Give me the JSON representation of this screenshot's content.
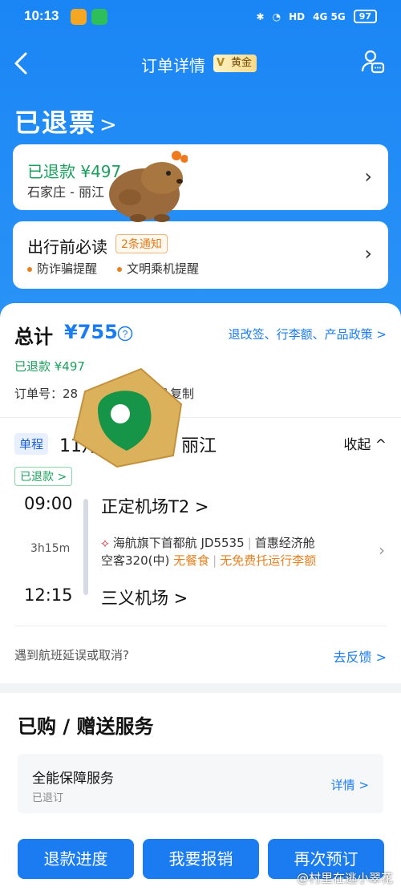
{
  "status_bar": {
    "time": "10:13",
    "signal": "4G 5G",
    "hd": "HD",
    "battery": "97"
  },
  "nav": {
    "title": "订单详情",
    "vip_label": "黄金"
  },
  "status_title": "已退票",
  "refund_card": {
    "amount_label": "已退款 ¥497",
    "route": "石家庄 - 丽江"
  },
  "notice_card": {
    "title": "出行前必读",
    "tag": "2条通知",
    "tips": [
      "防诈骗提醒",
      "文明乘机提醒"
    ]
  },
  "order": {
    "total_label": "总计",
    "total_amount": "¥755",
    "policy_link": "退改签、行李额、产品政策 >",
    "refunded": "已退款 ¥497",
    "order_no_label": "订单号：28",
    "copy_label": "复制"
  },
  "flight": {
    "type_tag": "单程",
    "route_title": "11月　　庄 — 丽江",
    "collapse": "收起 ^",
    "refund_tag": "已退款 >",
    "dep_time": "09:00",
    "dep_airport": "正定机场T2 >",
    "duration": "3h15m",
    "airline": "海航旗下首都航 JD5535",
    "cabin": "首惠经济舱",
    "aircraft": "空客320(中)",
    "meal": "无餐食",
    "baggage": "无免费托运行李额",
    "arr_time": "12:15",
    "arr_airport": "三义机场 >",
    "delay_question": "遇到航班延误或取消?",
    "feedback": "去反馈 >"
  },
  "services": {
    "title": "已购 / 赠送服务",
    "item_name": "全能保障服务",
    "item_status": "已退订",
    "item_detail": "详情 >"
  },
  "buttons": {
    "progress": "退款进度",
    "reimburse": "我要报销",
    "rebook": "再次预订"
  },
  "watermark": "@村里在逃小翠花",
  "colors": {
    "primary": "#1a7cf0",
    "header": "#1a86f5",
    "green": "#1aa05c",
    "orange": "#e8811f"
  }
}
